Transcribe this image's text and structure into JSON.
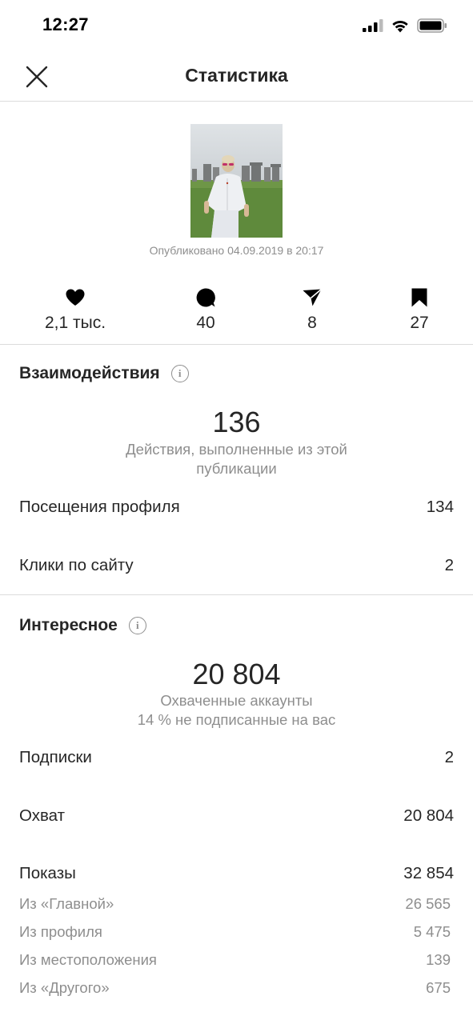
{
  "status_bar": {
    "time": "12:27"
  },
  "header": {
    "title": "Статистика"
  },
  "post": {
    "published": "Опубликовано 04.09.2019 в 20:17"
  },
  "counts": [
    {
      "icon": "heart-icon",
      "value": "2,1 тыс."
    },
    {
      "icon": "comment-icon",
      "value": "40"
    },
    {
      "icon": "share-icon",
      "value": "8"
    },
    {
      "icon": "bookmark-icon",
      "value": "27"
    }
  ],
  "interactions": {
    "title": "Взаимодействия",
    "total": "136",
    "caption": "Действия, выполненные из этой публикации",
    "rows": [
      {
        "label": "Посещения профиля",
        "value": "134"
      },
      {
        "label": "Клики по сайту",
        "value": "2"
      }
    ]
  },
  "discovery": {
    "title": "Интересное",
    "total": "20 804",
    "caption_line1": "Охваченные аккаунты",
    "caption_line2": "14 % не подписанные на вас",
    "rows": [
      {
        "label": "Подписки",
        "value": "2"
      },
      {
        "label": "Охват",
        "value": "20 804"
      },
      {
        "label": "Показы",
        "value": "32 854"
      }
    ],
    "impressions_breakdown": [
      {
        "label": "Из «Главной»",
        "value": "26 565"
      },
      {
        "label": "Из профиля",
        "value": "5 475"
      },
      {
        "label": "Из местоположения",
        "value": "139"
      },
      {
        "label": "Из «Другого»",
        "value": "675"
      }
    ]
  },
  "colors": {
    "text": "#262626",
    "secondary": "#8e8e8e",
    "divider": "#dbdbdb"
  }
}
